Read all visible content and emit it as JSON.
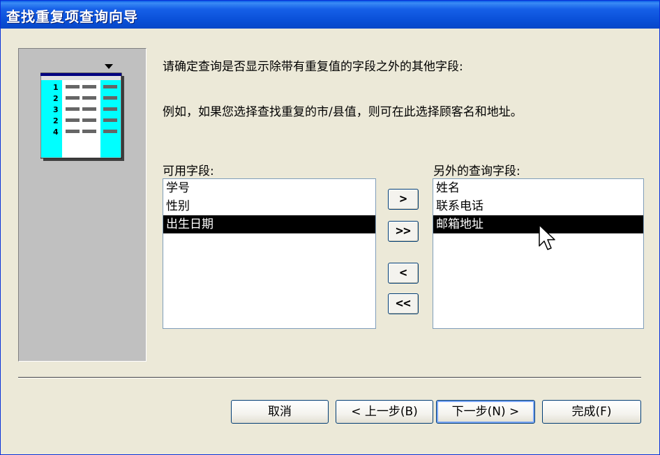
{
  "window": {
    "title": "查找重复项查询向导"
  },
  "illustration": {
    "row_numbers": [
      "1",
      "2",
      "3",
      "2",
      "4"
    ]
  },
  "instructions": {
    "line1": "请确定查询是否显示除带有重复值的字段之外的其他字段:",
    "line2": "例如，如果您选择查找重复的市/县值，则可在此选择顾客名和地址。"
  },
  "available": {
    "label": "可用字段:",
    "items": [
      "学号",
      "性别",
      "出生日期"
    ],
    "selected_index": 2
  },
  "additional": {
    "label": "另外的查询字段:",
    "items": [
      "姓名",
      "联系电话",
      "邮箱地址"
    ],
    "selected_index": 2
  },
  "move_buttons": {
    "add_one": ">",
    "add_all": ">>",
    "remove_one": "<",
    "remove_all": "<<"
  },
  "footer": {
    "cancel": "取消",
    "back": "< 上一步(B)",
    "next": "下一步(N) >",
    "finish": "完成(F)"
  }
}
